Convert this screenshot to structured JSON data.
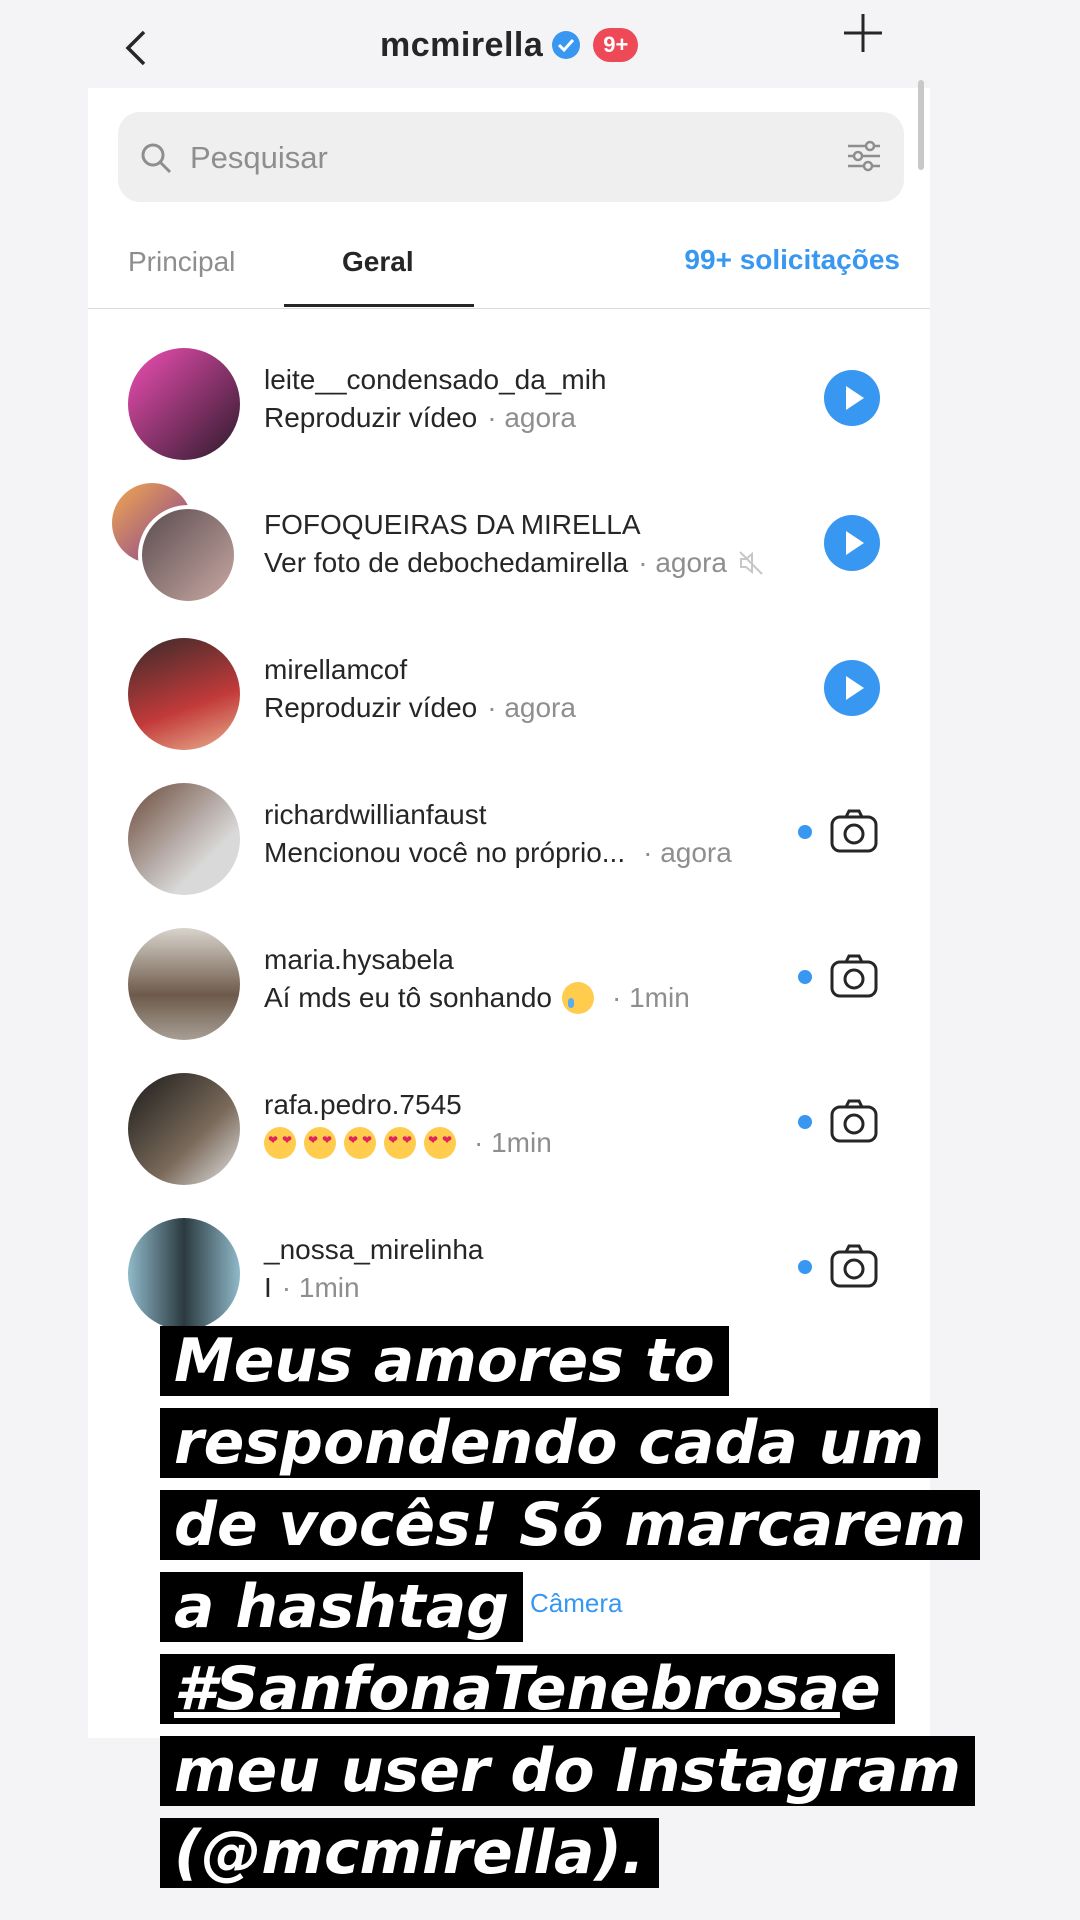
{
  "header": {
    "username": "mcmirella",
    "badge": "9+",
    "back_icon": "chevron-left-icon",
    "verified_icon": "verified-badge-icon",
    "new_icon": "plus-icon"
  },
  "search": {
    "placeholder": "Pesquisar",
    "filter_icon": "filter-icon"
  },
  "tabs": {
    "principal": "Principal",
    "geral": "Geral",
    "requests": "99+ solicitações"
  },
  "conversations": [
    {
      "name": "leite__condensado_da_mih",
      "message": "Reproduzir vídeo",
      "time": "· agora",
      "action": "play"
    },
    {
      "name": "FOFOQUEIRAS DA MIRELLA",
      "message": "Ver foto de debochedamirella",
      "time": "· agora",
      "action": "play",
      "muted": true
    },
    {
      "name": "mirellamcof",
      "message": "Reproduzir vídeo",
      "time": "· agora",
      "action": "play"
    },
    {
      "name": "richardwillianfaust",
      "message": "Mencionou você no próprio...",
      "time": "· agora",
      "action": "camera",
      "unread": true
    },
    {
      "name": "maria.hysabela",
      "message": "Aí mds eu tô sonhando",
      "time": "· 1min",
      "action": "camera",
      "unread": true
    },
    {
      "name": "rafa.pedro.7545",
      "message": "",
      "time": "· 1min",
      "action": "camera",
      "unread": true
    },
    {
      "name": "_nossa_mirelinha",
      "message": "I",
      "time": "· 1min",
      "action": "camera",
      "unread": true
    }
  ],
  "camera_link": "Câmera",
  "caption": {
    "line1": "Meus amores to",
    "line2": "respondendo cada um",
    "line3": "de vocês! Só marcarem",
    "line4": "a hashtag",
    "line5_tag": "#SanfonaTenebrosa",
    "line5_rest": " e",
    "line6": "meu user do Instagram",
    "line7": "(@mcmirella)."
  },
  "colors": {
    "accent": "#3897f0",
    "badge": "#ed4956",
    "text": "#262626",
    "muted": "#8e8e8e"
  }
}
